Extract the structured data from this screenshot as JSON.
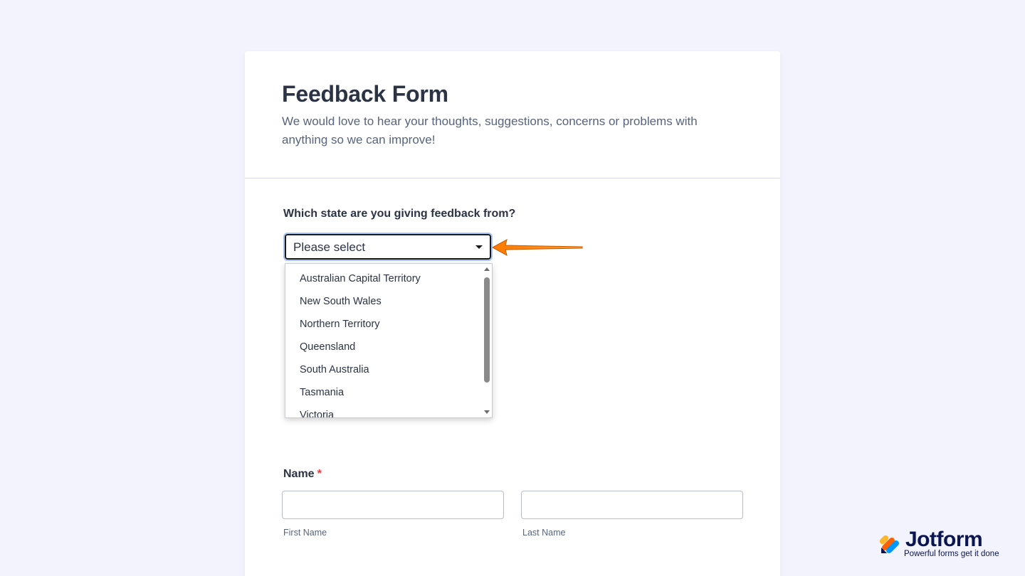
{
  "form": {
    "title": "Feedback Form",
    "subtitle": "We would love to hear your thoughts, suggestions, concerns or problems with anything so we can improve!"
  },
  "state_field": {
    "label": "Which state are you giving feedback from?",
    "selected_value": "Please select",
    "options": [
      "Australian Capital Territory",
      "New South Wales",
      "Northern Territory",
      "Queensland",
      "South Australia",
      "Tasmania",
      "Victoria"
    ]
  },
  "name_field": {
    "label": "Name",
    "required_marker": "*",
    "first_sublabel": "First Name",
    "last_sublabel": "Last Name",
    "first_value": "",
    "last_value": ""
  },
  "brand": {
    "name": "Jotform",
    "tagline": "Powerful forms get it done"
  },
  "colors": {
    "background": "#f3f3fe",
    "annotation_arrow": "#ff7a00",
    "required": "#f23a3c",
    "brand_text": "#0a1551"
  },
  "icons": {
    "dropdown_caret": "caret-down-icon",
    "annotation": "arrow-left-icon",
    "brand_logo": "jotform-logo-icon"
  }
}
